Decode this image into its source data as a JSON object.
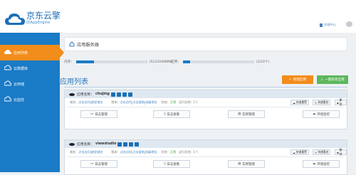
{
  "brand": {
    "title": "京东云擎",
    "subtitle": "JDAppEngine"
  },
  "topbar": {
    "user_label": "文档中心"
  },
  "sidebar": {
    "items": [
      {
        "label": "应用列表",
        "active": true
      },
      {
        "label": "云数据库",
        "active": false
      },
      {
        "label": "云存储",
        "active": false
      },
      {
        "label": "云监控",
        "active": false
      }
    ]
  },
  "page": {
    "title": "应用服务器"
  },
  "quota": {
    "memory": {
      "label": "内存：",
      "value": "(512/2048MB)",
      "fraction": 0.25
    },
    "apps": {
      "label": "应用：",
      "value": "(2/20个)",
      "fraction": 0.1
    }
  },
  "list": {
    "title": "应用列表",
    "new_button": "新建应用",
    "deploy_button": "一键安装应用"
  },
  "apps": [
    {
      "name_label": "应用名称：",
      "name": "chujing",
      "domain_label": "域名：",
      "domain_link": "点击访问",
      "manage_link": "绑定域名",
      "ver_label": "版本：",
      "ver_link": "点击访问",
      "ver_link2": "点击复制",
      "ver_link3": "低级地址",
      "status_label": "状态：",
      "status": "正常",
      "inst_label": "运行实例：",
      "inst": "1个",
      "actions": [
        "快速重置",
        "快速重启",
        "删除"
      ],
      "tools": [
        "日志管理",
        "日志查看",
        "实例管理",
        "环境监控"
      ]
    },
    {
      "name_label": "应用名称：",
      "name": "viewstudio",
      "domain_label": "域名：",
      "domain_link": "点击访问",
      "manage_link": "绑定域名",
      "ver_label": "版本：",
      "ver_link": "点击访问",
      "ver_link2": "点击复制",
      "ver_link3": "低级地址",
      "status_label": "状态：",
      "status": "正常",
      "inst_label": "运行实例：",
      "inst": "1个",
      "actions": [
        "快速重置",
        "快速重启",
        "删除"
      ],
      "tools": [
        "日志管理",
        "日志查看",
        "实例管理",
        "环境监控"
      ]
    }
  ],
  "colors": {
    "primary": "#1a7bc6",
    "accent": "#f28c1a",
    "success": "#5cb85c",
    "danger": "#d9534f"
  }
}
